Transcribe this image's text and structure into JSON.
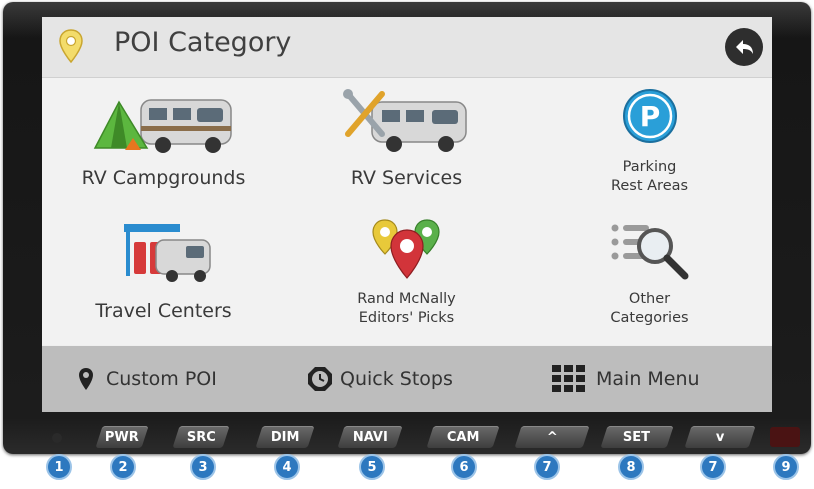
{
  "screen": {
    "title": "POI Category"
  },
  "categories": [
    {
      "label": "RV Campgrounds",
      "icon": "tent-rv-icon"
    },
    {
      "label": "RV Services",
      "icon": "wrench-rv-icon"
    },
    {
      "label_line1": "Parking",
      "label_line2": "Rest Areas",
      "icon": "parking-icon"
    },
    {
      "label": "Travel Centers",
      "icon": "fuel-station-rv-icon"
    },
    {
      "label_line1": "Rand McNally",
      "label_line2": "Editors' Picks",
      "icon": "map-pins-icon"
    },
    {
      "label_line1": "Other",
      "label_line2": "Categories",
      "icon": "list-magnifier-icon"
    }
  ],
  "bottom_bar": {
    "custom_poi": "Custom POI",
    "quick_stops": "Quick Stops",
    "main_menu": "Main Menu"
  },
  "hardware_buttons": [
    "PWR",
    "SRC",
    "DIM",
    "NAVI",
    "CAM",
    "^",
    "SET",
    "v"
  ],
  "badges": [
    "1",
    "2",
    "3",
    "4",
    "5",
    "6",
    "7",
    "8",
    "7",
    "9"
  ],
  "colors": {
    "badge": "#2d78bf",
    "parking": "#2a9fd8",
    "pin": "#e8d46a"
  }
}
